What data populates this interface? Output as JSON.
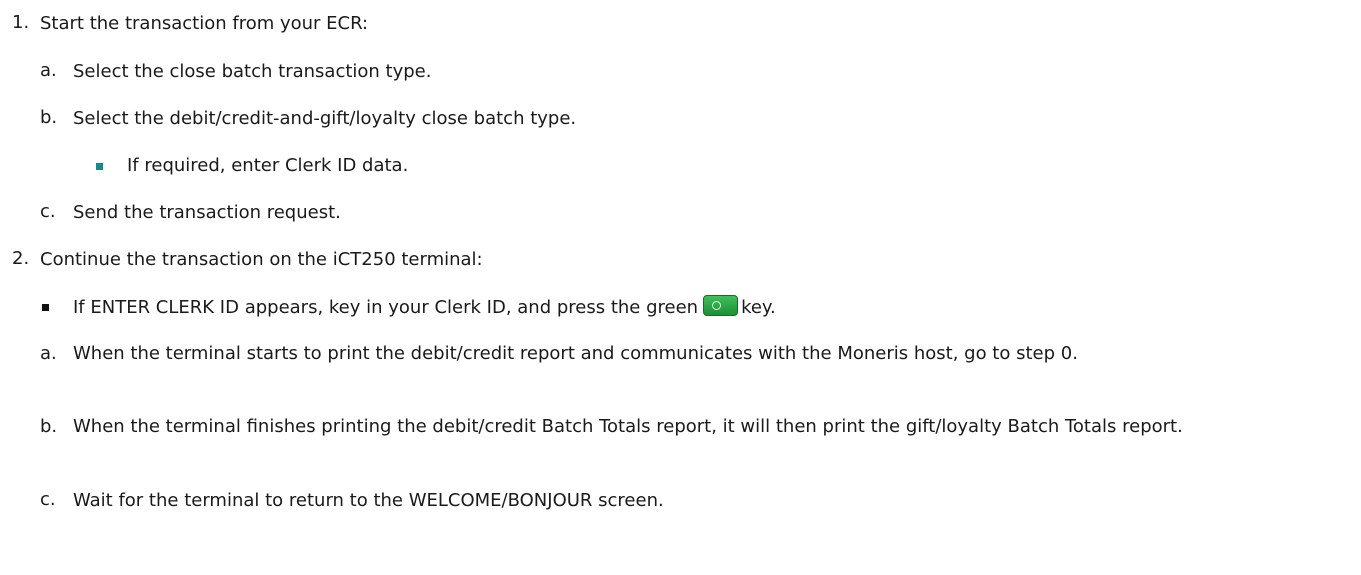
{
  "steps": [
    {
      "number": "1.",
      "text": "Start the transaction from your ECR:",
      "substeps": [
        {
          "letter": "a.",
          "text": "Select the close batch transaction type."
        },
        {
          "letter": "b.",
          "text": "Select the debit/credit-and-gift/loyalty close batch type.",
          "bullet": "If required, enter Clerk ID data."
        },
        {
          "letter": "c.",
          "text": "Send the transaction request."
        }
      ]
    },
    {
      "number": "2.",
      "text": "Continue the transaction on the iCT250 terminal:",
      "bullet_before": "If ENTER CLERK ID appears, key in your Clerk ID, and press the green",
      "bullet_after": "key.",
      "key_icon": "green-key-icon",
      "substeps": [
        {
          "letter": "a.",
          "text": "When the terminal starts to print the debit/credit report and communicates with the Moneris host, go to step 0."
        },
        {
          "letter": "b.",
          "text": "When the terminal finishes printing the debit/credit Batch Totals report, it will then print the gift/loyalty Batch Totals report."
        },
        {
          "letter": "c.",
          "text": "Wait for the terminal to return to the WELCOME/BONJOUR screen."
        }
      ]
    }
  ]
}
